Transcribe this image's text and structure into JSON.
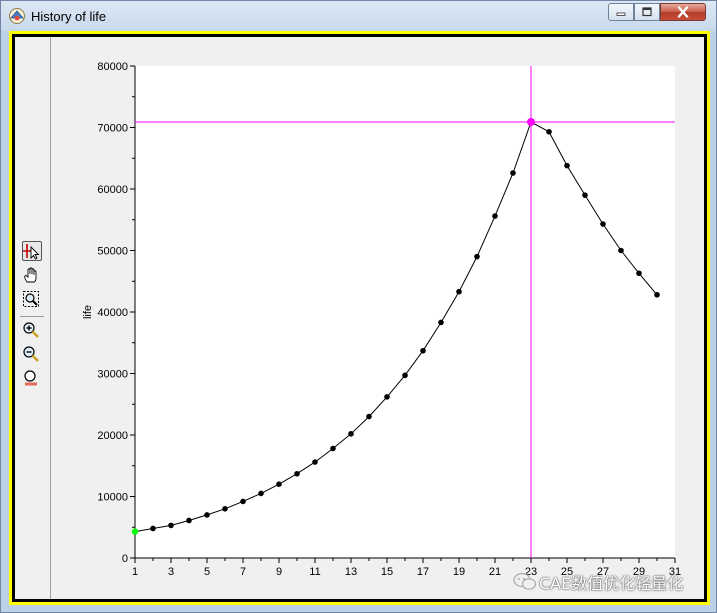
{
  "window": {
    "title": "History of life"
  },
  "icons": {
    "app": "app-icon",
    "minimize": "minimize-icon",
    "maximize": "maximize-icon",
    "close": "close-icon"
  },
  "toolbar": {
    "tools": [
      {
        "name": "select-crosshair-tool",
        "icon": "crosshair-pointer-icon",
        "active": true
      },
      {
        "name": "pan-tool",
        "icon": "hand-icon",
        "active": false
      },
      {
        "name": "zoom-box-tool",
        "icon": "zoom-box-icon",
        "active": false
      },
      {
        "name": "zoom-in-tool",
        "icon": "zoom-in-icon",
        "active": false
      },
      {
        "name": "zoom-out-tool",
        "icon": "zoom-out-icon",
        "active": false
      },
      {
        "name": "zoom-100-tool",
        "icon": "zoom-100-icon",
        "active": false
      }
    ]
  },
  "colors": {
    "crosshair": "#ff00ff",
    "series_line": "#000000",
    "first_point": "#00ff00",
    "plot_background": "#ffffff",
    "frame": "#ffff00"
  },
  "watermark": {
    "text": "CAE数值优化轻量化"
  },
  "chart_data": {
    "type": "line",
    "title": "",
    "xlabel": "",
    "ylabel": "life",
    "xlim": [
      1,
      31
    ],
    "ylim": [
      0,
      80000
    ],
    "x_ticks": [
      1,
      3,
      5,
      7,
      9,
      11,
      13,
      15,
      17,
      19,
      21,
      23,
      25,
      27,
      29,
      31
    ],
    "y_ticks": [
      0,
      10000,
      20000,
      30000,
      40000,
      50000,
      60000,
      70000,
      80000
    ],
    "grid": false,
    "series": [
      {
        "x": [
          1,
          2,
          3,
          4,
          5,
          6,
          7,
          8,
          9,
          10,
          11,
          12,
          13,
          14,
          15,
          16,
          17,
          18,
          19,
          20,
          21,
          22,
          23,
          24,
          25,
          26,
          27,
          28,
          29,
          30
        ],
        "values": [
          4300,
          4800,
          5300,
          6100,
          7000,
          8000,
          9200,
          10500,
          12000,
          13700,
          15600,
          17800,
          20200,
          23000,
          26200,
          29700,
          33700,
          38300,
          43300,
          49000,
          55600,
          62600,
          70900,
          69300,
          63800,
          59000,
          54300,
          50000,
          46300,
          42800
        ]
      }
    ],
    "crosshair": {
      "x": 23,
      "y": 70900
    }
  }
}
